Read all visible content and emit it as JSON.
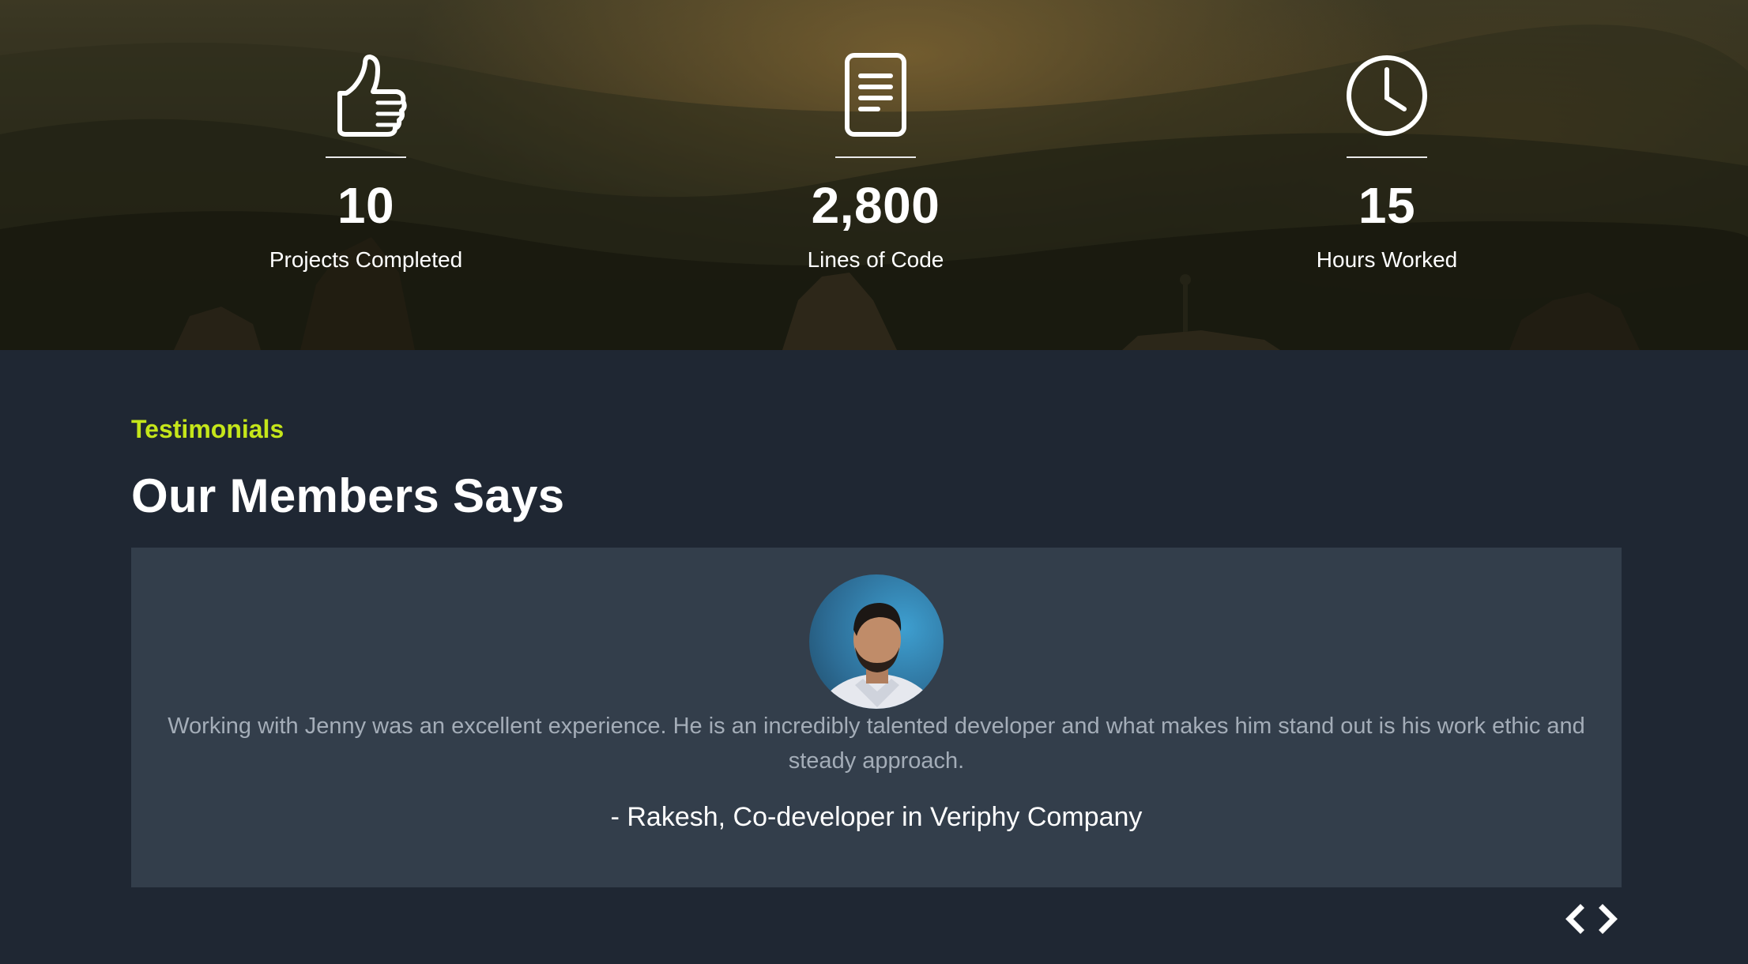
{
  "stats": [
    {
      "icon": "thumbs-up-icon",
      "value": "10",
      "label": "Projects Completed"
    },
    {
      "icon": "document-icon",
      "value": "2,800",
      "label": "Lines of Code"
    },
    {
      "icon": "clock-icon",
      "value": "15",
      "label": "Hours Worked"
    }
  ],
  "testimonials": {
    "eyebrow": "Testimonials",
    "heading": "Our Members Says",
    "quote": "Working with Jenny was an excellent experience. He is an incredibly talented developer and what makes him stand out is his work ethic and steady approach.",
    "author": "- Rakesh, Co-developer in Veriphy Company",
    "nav": {
      "prev_icon": "chevron-left-icon",
      "next_icon": "chevron-right-icon"
    }
  },
  "colors": {
    "accent": "#c5e61a",
    "background": "#1f2733",
    "card": "#333e4b",
    "quote_text": "#a4adb8"
  }
}
